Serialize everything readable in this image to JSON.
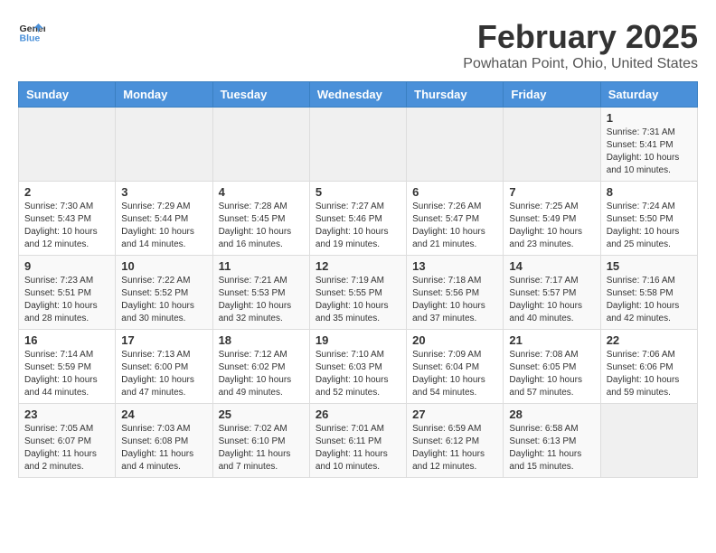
{
  "header": {
    "logo_general": "General",
    "logo_blue": "Blue",
    "month_year": "February 2025",
    "location": "Powhatan Point, Ohio, United States"
  },
  "weekdays": [
    "Sunday",
    "Monday",
    "Tuesday",
    "Wednesday",
    "Thursday",
    "Friday",
    "Saturday"
  ],
  "weeks": [
    [
      {
        "day": "",
        "empty": true
      },
      {
        "day": "",
        "empty": true
      },
      {
        "day": "",
        "empty": true
      },
      {
        "day": "",
        "empty": true
      },
      {
        "day": "",
        "empty": true
      },
      {
        "day": "",
        "empty": true
      },
      {
        "day": "1",
        "sunrise": "7:31 AM",
        "sunset": "5:41 PM",
        "daylight": "10 hours and 10 minutes."
      }
    ],
    [
      {
        "day": "2",
        "sunrise": "7:30 AM",
        "sunset": "5:43 PM",
        "daylight": "10 hours and 12 minutes."
      },
      {
        "day": "3",
        "sunrise": "7:29 AM",
        "sunset": "5:44 PM",
        "daylight": "10 hours and 14 minutes."
      },
      {
        "day": "4",
        "sunrise": "7:28 AM",
        "sunset": "5:45 PM",
        "daylight": "10 hours and 16 minutes."
      },
      {
        "day": "5",
        "sunrise": "7:27 AM",
        "sunset": "5:46 PM",
        "daylight": "10 hours and 19 minutes."
      },
      {
        "day": "6",
        "sunrise": "7:26 AM",
        "sunset": "5:47 PM",
        "daylight": "10 hours and 21 minutes."
      },
      {
        "day": "7",
        "sunrise": "7:25 AM",
        "sunset": "5:49 PM",
        "daylight": "10 hours and 23 minutes."
      },
      {
        "day": "8",
        "sunrise": "7:24 AM",
        "sunset": "5:50 PM",
        "daylight": "10 hours and 25 minutes."
      }
    ],
    [
      {
        "day": "9",
        "sunrise": "7:23 AM",
        "sunset": "5:51 PM",
        "daylight": "10 hours and 28 minutes."
      },
      {
        "day": "10",
        "sunrise": "7:22 AM",
        "sunset": "5:52 PM",
        "daylight": "10 hours and 30 minutes."
      },
      {
        "day": "11",
        "sunrise": "7:21 AM",
        "sunset": "5:53 PM",
        "daylight": "10 hours and 32 minutes."
      },
      {
        "day": "12",
        "sunrise": "7:19 AM",
        "sunset": "5:55 PM",
        "daylight": "10 hours and 35 minutes."
      },
      {
        "day": "13",
        "sunrise": "7:18 AM",
        "sunset": "5:56 PM",
        "daylight": "10 hours and 37 minutes."
      },
      {
        "day": "14",
        "sunrise": "7:17 AM",
        "sunset": "5:57 PM",
        "daylight": "10 hours and 40 minutes."
      },
      {
        "day": "15",
        "sunrise": "7:16 AM",
        "sunset": "5:58 PM",
        "daylight": "10 hours and 42 minutes."
      }
    ],
    [
      {
        "day": "16",
        "sunrise": "7:14 AM",
        "sunset": "5:59 PM",
        "daylight": "10 hours and 44 minutes."
      },
      {
        "day": "17",
        "sunrise": "7:13 AM",
        "sunset": "6:00 PM",
        "daylight": "10 hours and 47 minutes."
      },
      {
        "day": "18",
        "sunrise": "7:12 AM",
        "sunset": "6:02 PM",
        "daylight": "10 hours and 49 minutes."
      },
      {
        "day": "19",
        "sunrise": "7:10 AM",
        "sunset": "6:03 PM",
        "daylight": "10 hours and 52 minutes."
      },
      {
        "day": "20",
        "sunrise": "7:09 AM",
        "sunset": "6:04 PM",
        "daylight": "10 hours and 54 minutes."
      },
      {
        "day": "21",
        "sunrise": "7:08 AM",
        "sunset": "6:05 PM",
        "daylight": "10 hours and 57 minutes."
      },
      {
        "day": "22",
        "sunrise": "7:06 AM",
        "sunset": "6:06 PM",
        "daylight": "10 hours and 59 minutes."
      }
    ],
    [
      {
        "day": "23",
        "sunrise": "7:05 AM",
        "sunset": "6:07 PM",
        "daylight": "11 hours and 2 minutes."
      },
      {
        "day": "24",
        "sunrise": "7:03 AM",
        "sunset": "6:08 PM",
        "daylight": "11 hours and 4 minutes."
      },
      {
        "day": "25",
        "sunrise": "7:02 AM",
        "sunset": "6:10 PM",
        "daylight": "11 hours and 7 minutes."
      },
      {
        "day": "26",
        "sunrise": "7:01 AM",
        "sunset": "6:11 PM",
        "daylight": "11 hours and 10 minutes."
      },
      {
        "day": "27",
        "sunrise": "6:59 AM",
        "sunset": "6:12 PM",
        "daylight": "11 hours and 12 minutes."
      },
      {
        "day": "28",
        "sunrise": "6:58 AM",
        "sunset": "6:13 PM",
        "daylight": "11 hours and 15 minutes."
      },
      {
        "day": "",
        "empty": true
      }
    ]
  ]
}
